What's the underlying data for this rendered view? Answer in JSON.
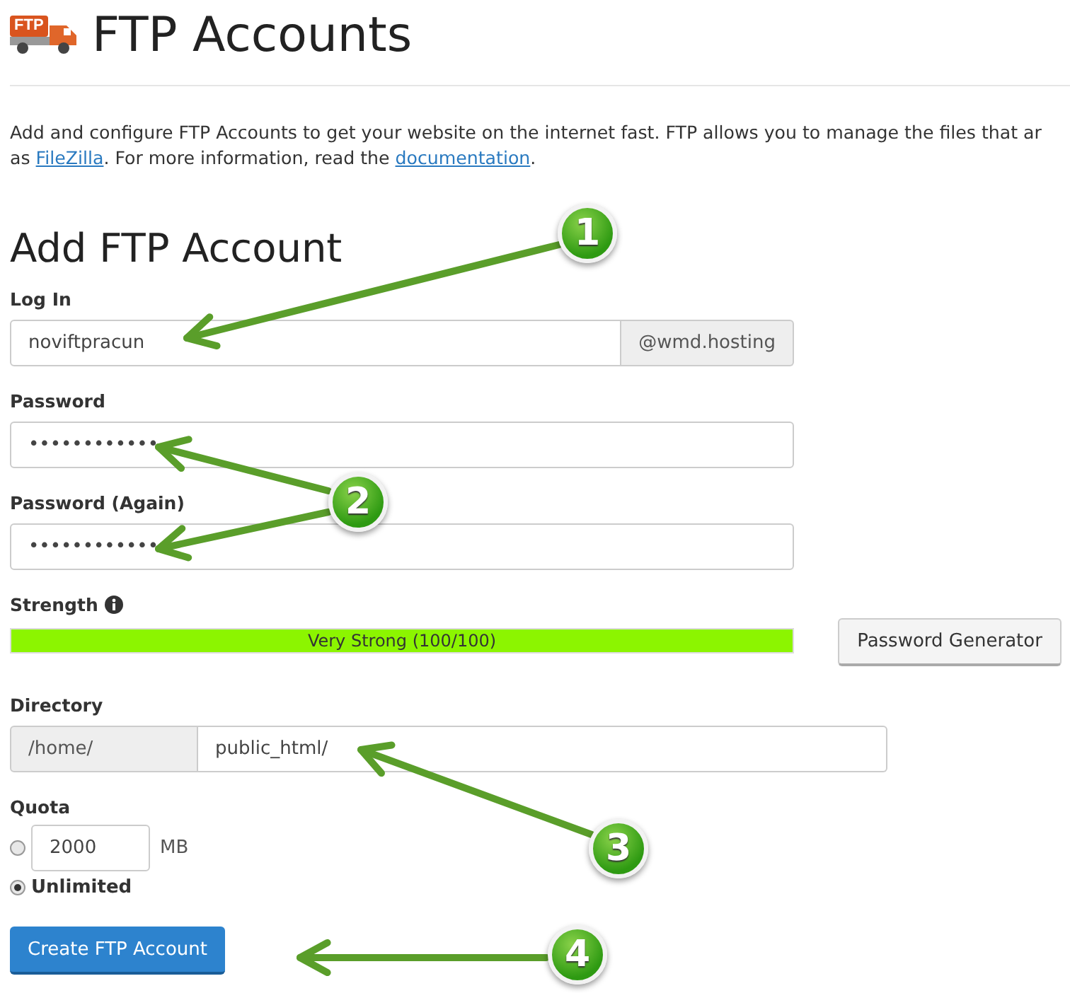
{
  "header": {
    "logo_text": "FTP",
    "title": "FTP Accounts"
  },
  "intro": {
    "lines": [
      [
        {
          "kind": "plain",
          "text": "Add and configure FTP Accounts to get your website on the internet fast. FTP allows you to manage the files that ar"
        }
      ],
      [
        {
          "kind": "plain",
          "text": "as "
        },
        {
          "kind": "link",
          "text": "FileZilla"
        },
        {
          "kind": "plain",
          "text": ". For more information, read the "
        },
        {
          "kind": "link",
          "text": "documentation"
        },
        {
          "kind": "plain",
          "text": "."
        }
      ]
    ]
  },
  "form": {
    "title": "Add FTP Account",
    "login": {
      "label": "Log In",
      "value": "noviftpracun",
      "suffix": "@wmd.hosting"
    },
    "password": {
      "label": "Password",
      "value": "••••••••••••"
    },
    "password_again": {
      "label": "Password (Again)",
      "value": "••••••••••••"
    },
    "strength": {
      "label": "Strength",
      "level": 1,
      "reading": "Very Strong (100/100)"
    },
    "generator_button": "Password Generator",
    "directory": {
      "label": "Directory",
      "prefix": "/home/",
      "value": "public_html/"
    },
    "quota": {
      "label": "Quota",
      "options": [
        {
          "kind": "limit",
          "value": "2000",
          "unit": "MB",
          "selected": false
        },
        {
          "kind": "unlimited",
          "label": "Unlimited",
          "selected": true
        }
      ]
    },
    "submit": "Create FTP Account"
  },
  "annotations": [
    {
      "number": "1"
    },
    {
      "number": "2"
    },
    {
      "number": "3"
    },
    {
      "number": "4"
    }
  ]
}
